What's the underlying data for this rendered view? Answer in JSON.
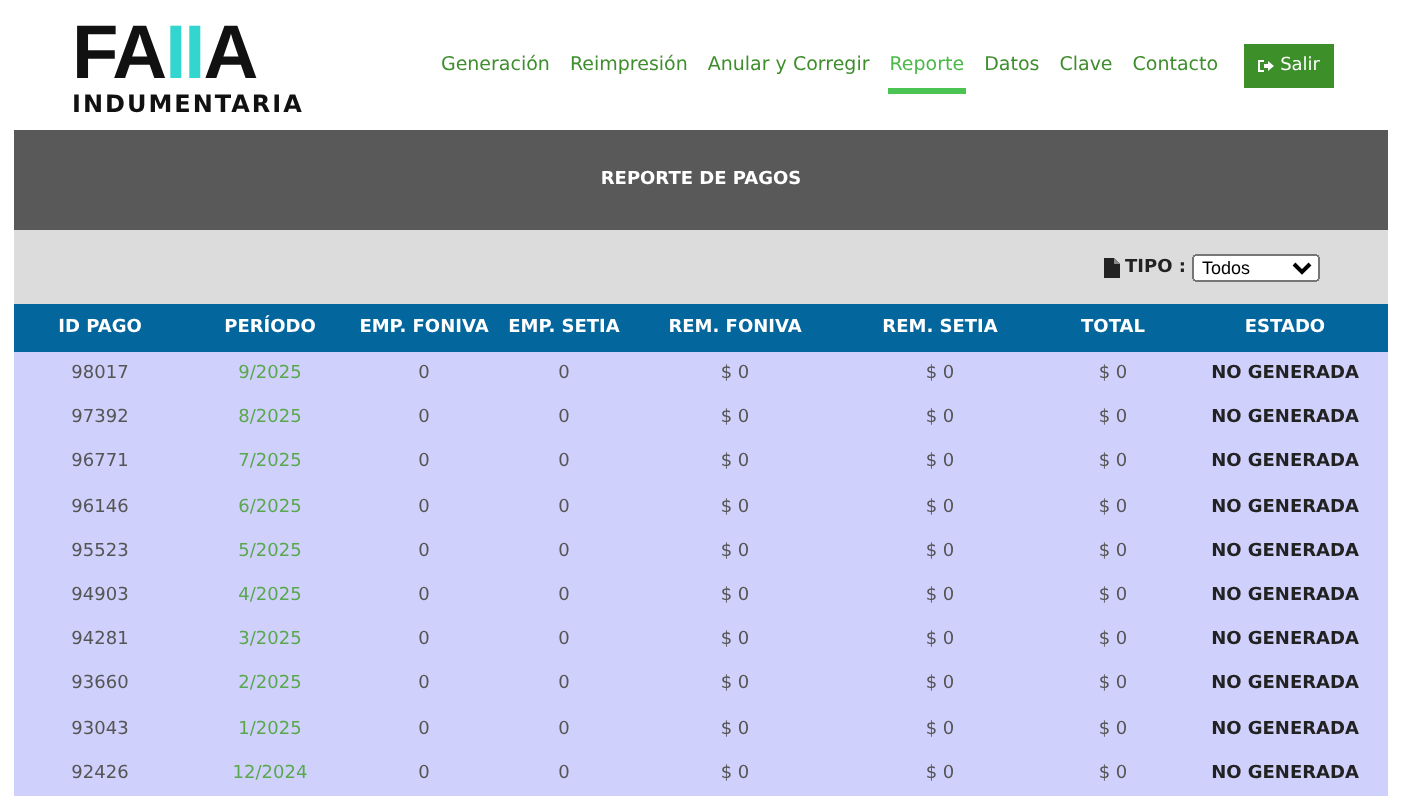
{
  "logo": {
    "parts": [
      {
        "text": "FA",
        "color": "#111111"
      },
      {
        "text": "II",
        "color": "#33d6cf"
      },
      {
        "text": "A",
        "color": "#111111"
      }
    ],
    "subtitle": "INDUMENTARIA"
  },
  "nav": [
    {
      "label": "Generación",
      "selected": false
    },
    {
      "label": "Reimpresión",
      "selected": false
    },
    {
      "label": "Anular y Corregir",
      "selected": false
    },
    {
      "label": "Reporte",
      "selected": true
    },
    {
      "label": "Datos",
      "selected": false
    },
    {
      "label": "Clave",
      "selected": false
    },
    {
      "label": "Contacto",
      "selected": false
    }
  ],
  "logout_button": "Salir",
  "report": {
    "title": "REPORTE DE PAGOS",
    "filter": {
      "label": "TIPO :",
      "value": "Todos"
    },
    "table": {
      "columns": [
        "ID PAGO",
        "PERÍODO",
        "EMP. FONIVA",
        "EMP. SETIA",
        "REM. FONIVA",
        "REM. SETIA",
        "TOTAL",
        "ESTADO"
      ],
      "rows": [
        [
          "98017",
          "9/2025",
          "0",
          "0",
          "$ 0",
          "$ 0",
          "$ 0",
          "NO GENERADA"
        ],
        [
          "97392",
          "8/2025",
          "0",
          "0",
          "$ 0",
          "$ 0",
          "$ 0",
          "NO GENERADA"
        ],
        [
          "96771",
          "7/2025",
          "0",
          "0",
          "$ 0",
          "$ 0",
          "$ 0",
          "NO GENERADA"
        ],
        [
          "96146",
          "6/2025",
          "0",
          "0",
          "$ 0",
          "$ 0",
          "$ 0",
          "NO GENERADA"
        ],
        [
          "95523",
          "5/2025",
          "0",
          "0",
          "$ 0",
          "$ 0",
          "$ 0",
          "NO GENERADA"
        ],
        [
          "94903",
          "4/2025",
          "0",
          "0",
          "$ 0",
          "$ 0",
          "$ 0",
          "NO GENERADA"
        ],
        [
          "94281",
          "3/2025",
          "0",
          "0",
          "$ 0",
          "$ 0",
          "$ 0",
          "NO GENERADA"
        ],
        [
          "93660",
          "2/2025",
          "0",
          "0",
          "$ 0",
          "$ 0",
          "$ 0",
          "NO GENERADA"
        ],
        [
          "93043",
          "1/2025",
          "0",
          "0",
          "$ 0",
          "$ 0",
          "$ 0",
          "NO GENERADA"
        ],
        [
          "92426",
          "12/2024",
          "0",
          "0",
          "$ 0",
          "$ 0",
          "$ 0",
          "NO GENERADA"
        ]
      ]
    }
  }
}
